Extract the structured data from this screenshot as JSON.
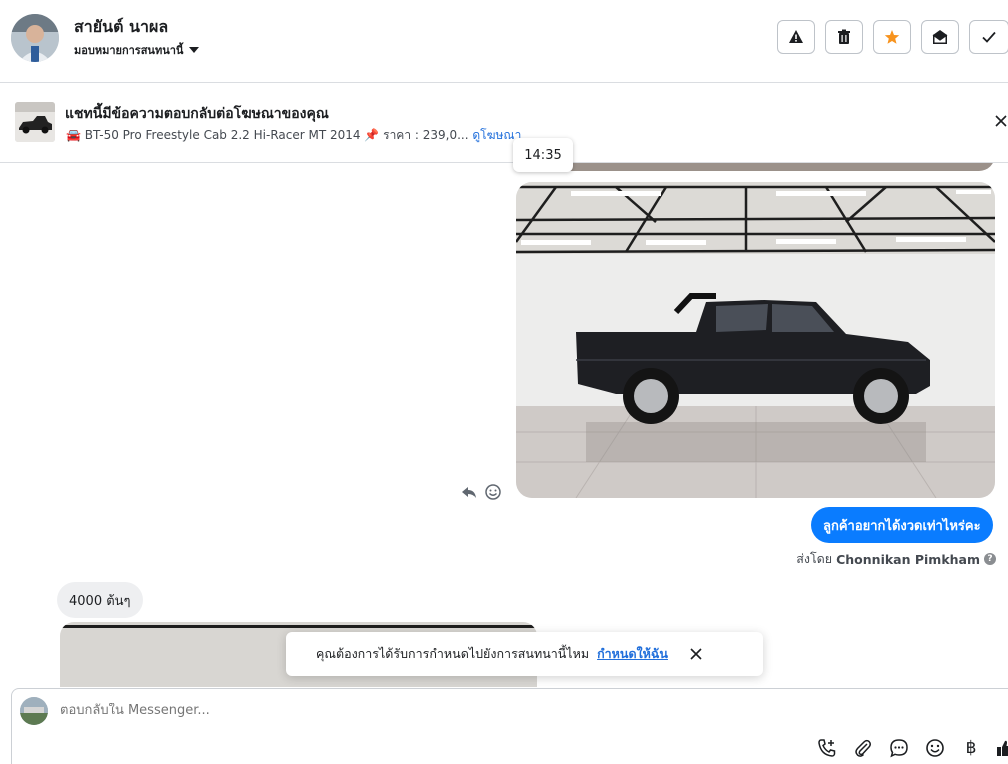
{
  "header": {
    "contact_name": "สายันต์ นาผล",
    "assign_label": "มอบหมายการสนทนานี้",
    "actions": [
      {
        "icon": "warning-icon",
        "label": "report"
      },
      {
        "icon": "trash-icon",
        "label": "delete"
      },
      {
        "icon": "star-icon",
        "label": "favorite",
        "color": "#f7931e"
      },
      {
        "icon": "envelope-open-icon",
        "label": "mark-unread"
      },
      {
        "icon": "check-icon",
        "label": "done"
      }
    ]
  },
  "ad_banner": {
    "title": "แชทนี้มีข้อความตอบกลับต่อโฆษณาของคุณ",
    "car_emoji": "🚘",
    "description": "BT-50 Pro Freestyle Cab 2.2 Hi-Racer MT 2014",
    "pin_emoji": "📌",
    "price": "ราคา : 239,0...",
    "link": "ดูโฆษณา"
  },
  "thread": {
    "timestamp_tooltip": "14:35",
    "outgoing_message": "ลูกค้าอยากได้งวดเท่าไหร่คะ",
    "sent_by_prefix": "ส่งโดย",
    "sent_by_name": "Chonnikan Pimkham",
    "incoming_message": "4000 ต้นๆ"
  },
  "toast": {
    "text": "คุณต้องการได้รับการกำหนดไปยังการสนทนานี้ไหม",
    "link": "กำหนดให้ฉัน"
  },
  "composer": {
    "placeholder": "ตอบกลับใน Messenger...",
    "currency_symbol": "฿"
  },
  "colors": {
    "accent_blue": "#0a7cff",
    "link_blue": "#216fdb",
    "star_orange": "#f7931e",
    "bubble_gray": "#eeeff1"
  }
}
